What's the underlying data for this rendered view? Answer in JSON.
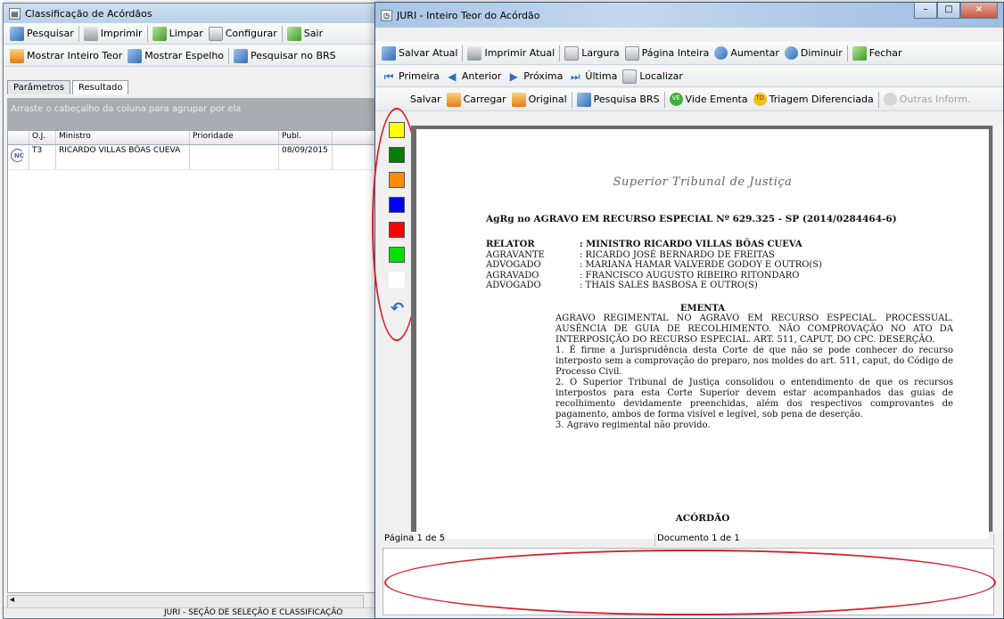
{
  "w1": {
    "title": "Classificação de Acórdãos",
    "tb1": [
      "Pesquisar",
      "Imprimir",
      "Limpar",
      "Configurar",
      "Sair"
    ],
    "tb2": [
      "Mostrar Inteiro Teor",
      "Mostrar Espelho",
      "Pesquisar no BRS"
    ],
    "tabs": [
      "Parâmetros",
      "Resultado"
    ],
    "group_hint": "Arraste o cabeçalho da coluna para agrupar por ela",
    "columns": [
      "",
      "O.J.",
      "Ministro",
      "Prioridade",
      "Publ."
    ],
    "row": {
      "badge": "NC",
      "oj": "T3",
      "ministro": "RICARDO VILLAS BÔAS CUEVA",
      "prioridade": "",
      "publ": "08/09/2015"
    },
    "status": "JURI - SEÇÃO DE SELEÇÃO E CLASSIFICAÇÃO"
  },
  "w2": {
    "title": "JURI - Inteiro Teor do Acórdão",
    "tb1": [
      "Salvar Atual",
      "Imprimir Atual",
      "Largura",
      "Página Inteira",
      "Aumentar",
      "Diminuir",
      "Fechar"
    ],
    "tb2": [
      "Primeira",
      "Anterior",
      "Próxima",
      "Última",
      "Localizar"
    ],
    "tb3": [
      "Salvar",
      "Carregar",
      "Original",
      "Pesquisa BRS",
      "Vide Ementa",
      "Triagem Diferenciada",
      "Outras Inform."
    ],
    "badges": {
      "ve": "VE",
      "td": "TD"
    },
    "palette": [
      "#ffff00",
      "#0a7a0a",
      "#ff8c00",
      "#0000ff",
      "#ff0000",
      "#00e000",
      "#ffffff"
    ],
    "status": {
      "page": "Página 1 de 5",
      "doc": "Documento 1 de 1"
    },
    "doc": {
      "court": "Superior Tribunal de Justiça",
      "title": "AgRg no AGRAVO EM RECURSO ESPECIAL Nº 629.325 - SP (2014/0284464-6)",
      "parties": [
        {
          "k": "RELATOR",
          "v": ": MINISTRO RICARDO VILLAS BÔAS CUEVA"
        },
        {
          "k": "AGRAVANTE",
          "v": ": RICARDO JOSÉ BERNARDO DE FREITAS"
        },
        {
          "k": "ADVOGADO",
          "v": ": MARIANA HAMAR VALVERDE GODOY E OUTRO(S)"
        },
        {
          "k": "AGRAVADO",
          "v": ": FRANCISCO AUGUSTO RIBEIRO RITONDARO"
        },
        {
          "k": "ADVOGADO",
          "v": ": THAIS SALES BASBOSA E OUTRO(S)"
        }
      ],
      "ementa_label": "EMENTA",
      "ementa_head": "AGRAVO REGIMENTAL NO AGRAVO EM RECURSO ESPECIAL. PROCESSUAL. AUSÊNCIA DE GUIA DE RECOLHIMENTO. NÃO COMPROVAÇÃO NO ATO DA INTERPOSIÇÃO DO RECURSO ESPECIAL. ART. 511, CAPUT, DO CPC. DESERÇÃO.",
      "item1": "1. É firme a Jurisprudência desta Corte de que não se pode conhecer do recurso interposto sem a comprovação do preparo, nos moldes do art. 511, caput, do Código de Processo Civil.",
      "item2": "2. O Superior Tribunal de Justiça consolidou o entendimento de que os recursos interpostos para esta Corte Superior devem estar acompanhados das guias de recolhimento devidamente preenchidas, além dos respectivos comprovantes de pagamento, ambos de forma visível e legível, sob pena de deserção.",
      "item3": "3. Agravo regimental não provido.",
      "acordao": "ACÓRDÃO"
    }
  }
}
